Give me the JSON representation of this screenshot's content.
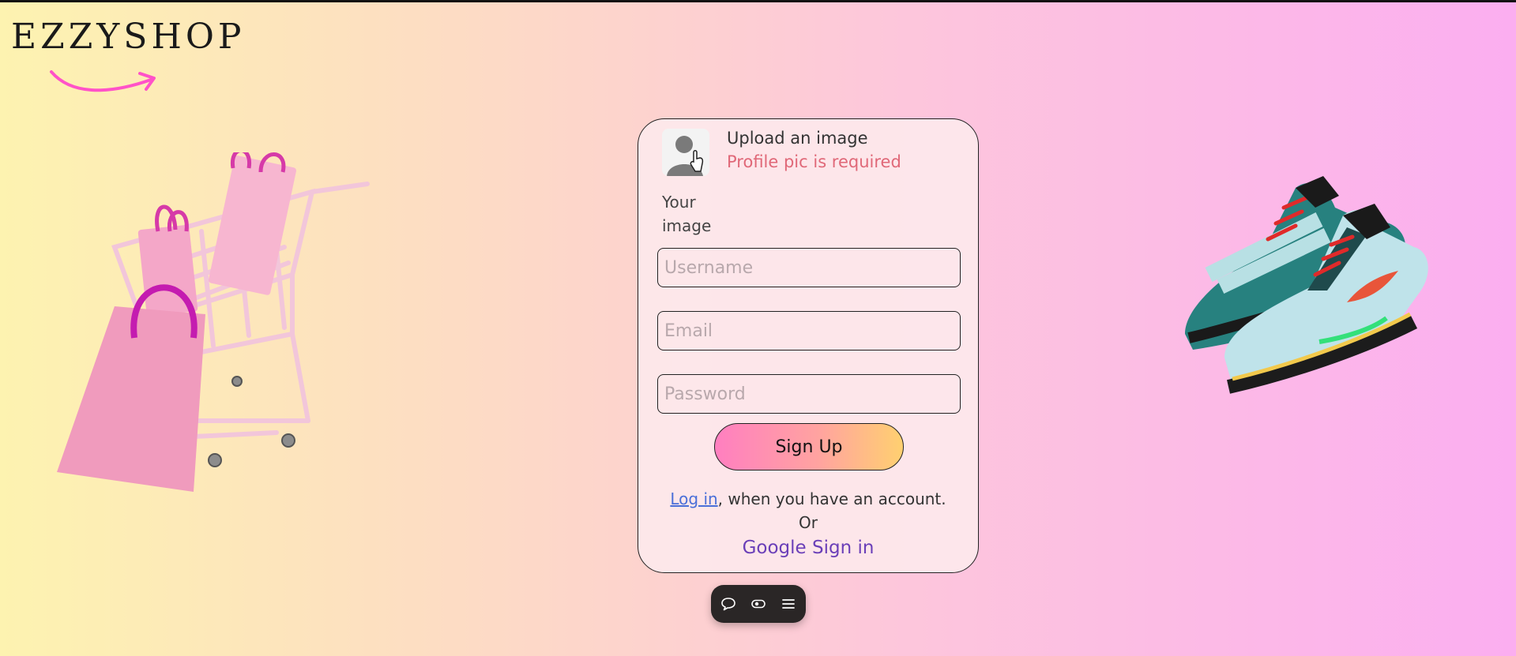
{
  "brand": {
    "logo_text": "EZZYSHOP"
  },
  "signup_form": {
    "upload_label": "Upload an image",
    "upload_error": "Profile pic is required",
    "your_image_label": "Your image",
    "username_placeholder": "Username",
    "email_placeholder": "Email",
    "password_placeholder": "Password",
    "signup_button": "Sign Up",
    "login_link": "Log in",
    "login_suffix": ", when you have an account.",
    "or_text": "Or",
    "google_signin": "Google Sign in"
  },
  "toolbar": {
    "icons": [
      "comment-icon",
      "toggle-icon",
      "menu-icon"
    ]
  },
  "colors": {
    "error": "#e06878",
    "link": "#4a6fd8",
    "google": "#6a3fb8",
    "accent_pink": "#ff7fc0",
    "accent_yellow": "#ffd070"
  }
}
